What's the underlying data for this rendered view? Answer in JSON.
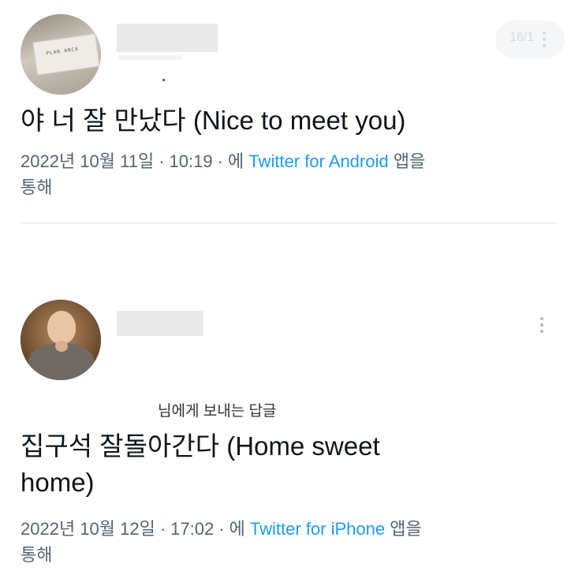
{
  "tweets": [
    {
      "avatar_icon": "plan-card-photo",
      "avatar_card_text": "PLAN ANCA",
      "counter": "16/1",
      "text_lines": [
        "야 너 잘 만났다 (Nice to meet you)"
      ],
      "date": "2022년 10월 11일",
      "time": "10:19",
      "via_prefix": "에",
      "source": "Twitter for Android",
      "via_suffix_1": "앱을",
      "via_suffix_2": "통해"
    },
    {
      "avatar_icon": "bald-man-portrait",
      "reply_to": "님에게 보내는 답글",
      "text_lines": [
        "집구석 잘돌아간다 (Home sweet",
        "home)"
      ],
      "date": "2022년 10월 12일",
      "time": "17:02",
      "via_prefix": "에",
      "source": "Twitter for iPhone",
      "via_suffix_1": "앱을",
      "via_suffix_2": "통해"
    }
  ],
  "icons": {
    "more": "more-vertical-icon"
  },
  "colors": {
    "link": "#1d9bf0",
    "meta": "#536471",
    "text": "#0f1419"
  }
}
